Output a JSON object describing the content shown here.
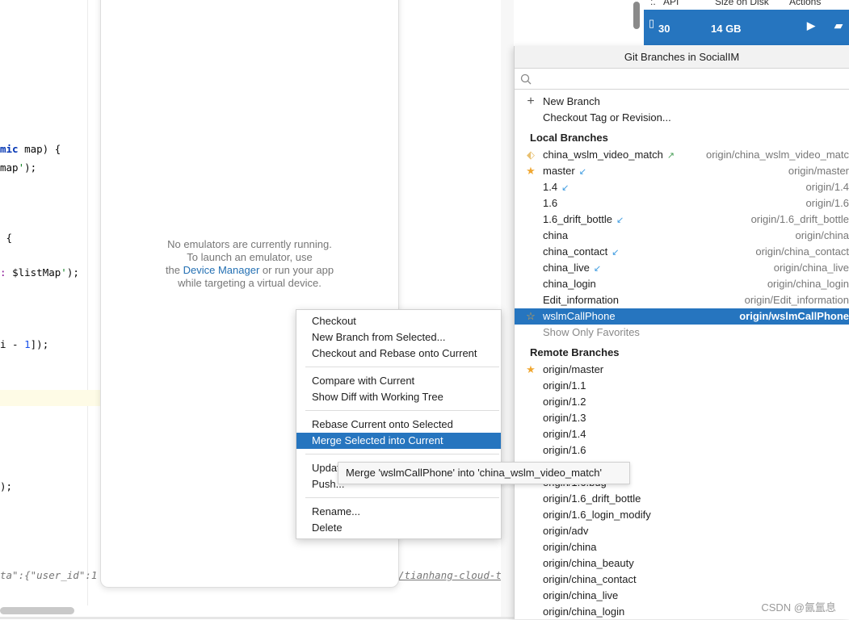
{
  "editor": {
    "lines": [
      {
        "kw": "mic",
        "rest": " map) {"
      },
      {
        "pre": "map",
        "str": "'",
        "rest": ");"
      },
      {
        "rest": " {"
      },
      {
        "str": ": ",
        "rest": "$listMap",
        "str2": "'",
        "rest2": ");"
      },
      {
        "rest": "i - ",
        "num": "1",
        "rest2": "]);"
      },
      {
        "rest": ");"
      }
    ],
    "log_left": "ta\":{\"user_id\":1",
    "log_link": "/tianhang-cloud-tes"
  },
  "emulator": {
    "line1": "No emulators are currently running.",
    "line2": "To launch an emulator, use",
    "line3_pre": "the ",
    "link": "Device Manager",
    "line3_post": " or run your app",
    "line4": "while targeting a virtual device."
  },
  "device_manager": {
    "headers": [
      ":.",
      "API",
      "Size on Disk",
      "Actions"
    ],
    "api": "30",
    "size": "14 GB"
  },
  "popup": {
    "title": "Git Branches in SocialIM",
    "search_placeholder": "",
    "actions": [
      "New Branch",
      "Checkout Tag or Revision..."
    ],
    "local_header": "Local Branches",
    "local": [
      {
        "name": "china_wslm_video_match",
        "icon": "tag-icon",
        "arrow": "outgoing",
        "remote": "origin/china_wslm_video_matc"
      },
      {
        "name": "master",
        "icon": "star-filled-icon",
        "arrow": "incoming",
        "remote": "origin/master"
      },
      {
        "name": "1.4",
        "arrow": "incoming",
        "remote": "origin/1.4"
      },
      {
        "name": "1.6",
        "remote": "origin/1.6"
      },
      {
        "name": "1.6_drift_bottle",
        "arrow": "incoming",
        "remote": "origin/1.6_drift_bottle"
      },
      {
        "name": "china",
        "remote": "origin/china"
      },
      {
        "name": "china_contact",
        "arrow": "incoming",
        "remote": "origin/china_contact"
      },
      {
        "name": "china_live",
        "arrow": "incoming",
        "remote": "origin/china_live"
      },
      {
        "name": "china_login",
        "remote": "origin/china_login"
      },
      {
        "name": "Edit_information",
        "remote": "origin/Edit_information"
      },
      {
        "name": "wslmCallPhone",
        "icon": "star-outline-icon",
        "remote": "origin/wslmCallPhone",
        "selected": true
      }
    ],
    "show_favorites": "Show Only Favorites",
    "remote_header": "Remote Branches",
    "remote": [
      {
        "name": "origin/master",
        "icon": "star-filled-icon"
      },
      {
        "name": "origin/1.1"
      },
      {
        "name": "origin/1.2"
      },
      {
        "name": "origin/1.3"
      },
      {
        "name": "origin/1.4"
      },
      {
        "name": "origin/1.6"
      },
      {
        "name": "origin/1.6"
      },
      {
        "name": "origin/1.6.bug"
      },
      {
        "name": "origin/1.6_drift_bottle"
      },
      {
        "name": "origin/1.6_login_modify"
      },
      {
        "name": "origin/adv"
      },
      {
        "name": "origin/china"
      },
      {
        "name": "origin/china_beauty"
      },
      {
        "name": "origin/china_contact"
      },
      {
        "name": "origin/china_live"
      },
      {
        "name": "origin/china_login"
      }
    ]
  },
  "context_menu": {
    "groups": [
      [
        "Checkout",
        "New Branch from Selected...",
        "Checkout and Rebase onto Current"
      ],
      [
        "Compare with Current",
        "Show Diff with Working Tree"
      ],
      [
        "Rebase Current onto Selected",
        "Merge Selected into Current"
      ],
      [
        "Update",
        "Push..."
      ],
      [
        "Rename...",
        "Delete"
      ]
    ],
    "selected": "Merge Selected into Current"
  },
  "tooltip": "Merge 'wslmCallPhone' into 'china_wslm_video_match'",
  "watermark": "CSDN @氤氲息",
  "colors": {
    "accent": "#2675bf",
    "star": "#f0a732",
    "arrow_in": "#3d9be0",
    "arrow_out": "#4aa05a"
  }
}
